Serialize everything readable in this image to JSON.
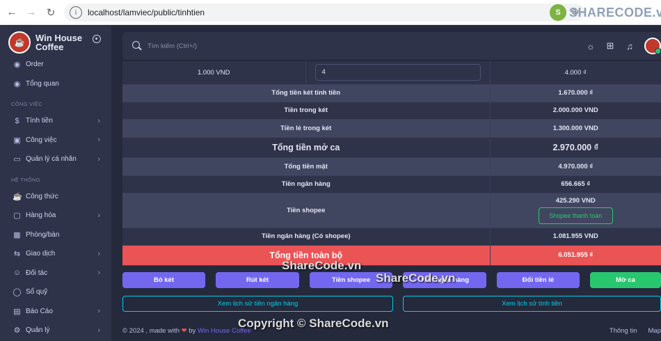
{
  "browser": {
    "url": "localhost/lamviec/public/tinhtien"
  },
  "watermark": {
    "logo_text": "SHARECODE.vn",
    "center_text": "ShareCode.vn",
    "bottom_text": "Copyright © ShareCode.vn"
  },
  "sidebar": {
    "brand": "Win House Coffee",
    "items_top": [
      {
        "label": "Order",
        "icon": "eye-icon"
      },
      {
        "label": "Tổng quan",
        "icon": "eye-icon"
      }
    ],
    "section1": "CÔNG VIỆC",
    "items_work": [
      {
        "label": "Tính tiền",
        "icon": "money-icon",
        "has_children": true
      },
      {
        "label": "Công việc",
        "icon": "briefcase-icon",
        "has_children": true
      },
      {
        "label": "Quản lý cá nhân",
        "icon": "monitor-icon",
        "has_children": true
      }
    ],
    "section2": "HỆ THỐNG",
    "items_system": [
      {
        "label": "Công thức",
        "icon": "cup-icon",
        "has_children": false
      },
      {
        "label": "Hàng hóa",
        "icon": "box-icon",
        "has_children": true
      },
      {
        "label": "Phòng/bàn",
        "icon": "table-icon",
        "has_children": false
      },
      {
        "label": "Giao dịch",
        "icon": "exchange-icon",
        "has_children": true
      },
      {
        "label": "Đối tác",
        "icon": "user-icon",
        "has_children": true
      },
      {
        "label": "Sổ quỹ",
        "icon": "coin-icon",
        "has_children": false
      },
      {
        "label": "Báo Cáo",
        "icon": "report-icon",
        "has_children": true
      },
      {
        "label": "Quản lý",
        "icon": "gear-icon",
        "has_children": true
      }
    ]
  },
  "topbar": {
    "search_placeholder": "Tìm kiếm (Ctrl+/)"
  },
  "table": {
    "first_row": {
      "unit_price": "1.000 VND",
      "quantity": "4",
      "amount": "4.000 ₫"
    },
    "rows": [
      {
        "label": "Tổng tiền két tính tiền",
        "value": "1.670.000 ₫"
      },
      {
        "label": "Tiền trong két",
        "value": "2.000.000 VND"
      },
      {
        "label": "Tiền lẻ trong két",
        "value": "1.300.000 VND"
      },
      {
        "label": "Tổng tiền mở ca",
        "value": "2.970.000 ₫"
      },
      {
        "label": "Tổng tiền mặt",
        "value": "4.970.000 ₫"
      },
      {
        "label": "Tiền ngân hàng",
        "value": "656.665 ₫"
      },
      {
        "label": "Tiền shopee",
        "value": "425.290 VND",
        "button": "Shopee thanh toán"
      },
      {
        "label": "Tiền ngân hàng (Có shopee)",
        "value": "1.081.955 VND"
      },
      {
        "label": "Tổng tiền toàn bộ",
        "value": "6.051.955 ₫"
      }
    ]
  },
  "actions": {
    "buttons": [
      "Bỏ két",
      "Rút két",
      "Tiền shopee",
      "Tiền ngân hàng",
      "Đổi tiền lẻ",
      "Mở ca"
    ],
    "history_bank": "Xem lịch sử tiền ngân hàng",
    "history_calc": "Xem lịch sử tính tiền"
  },
  "footer": {
    "prefix": "© 2024 , made with",
    "by": "by",
    "brand": "Win House Coffee",
    "links": [
      "Thông tin",
      "Map"
    ]
  },
  "colors": {
    "primary": "#7367f0",
    "success": "#28c76f",
    "danger": "#ea5455",
    "info": "#00cfe8"
  }
}
